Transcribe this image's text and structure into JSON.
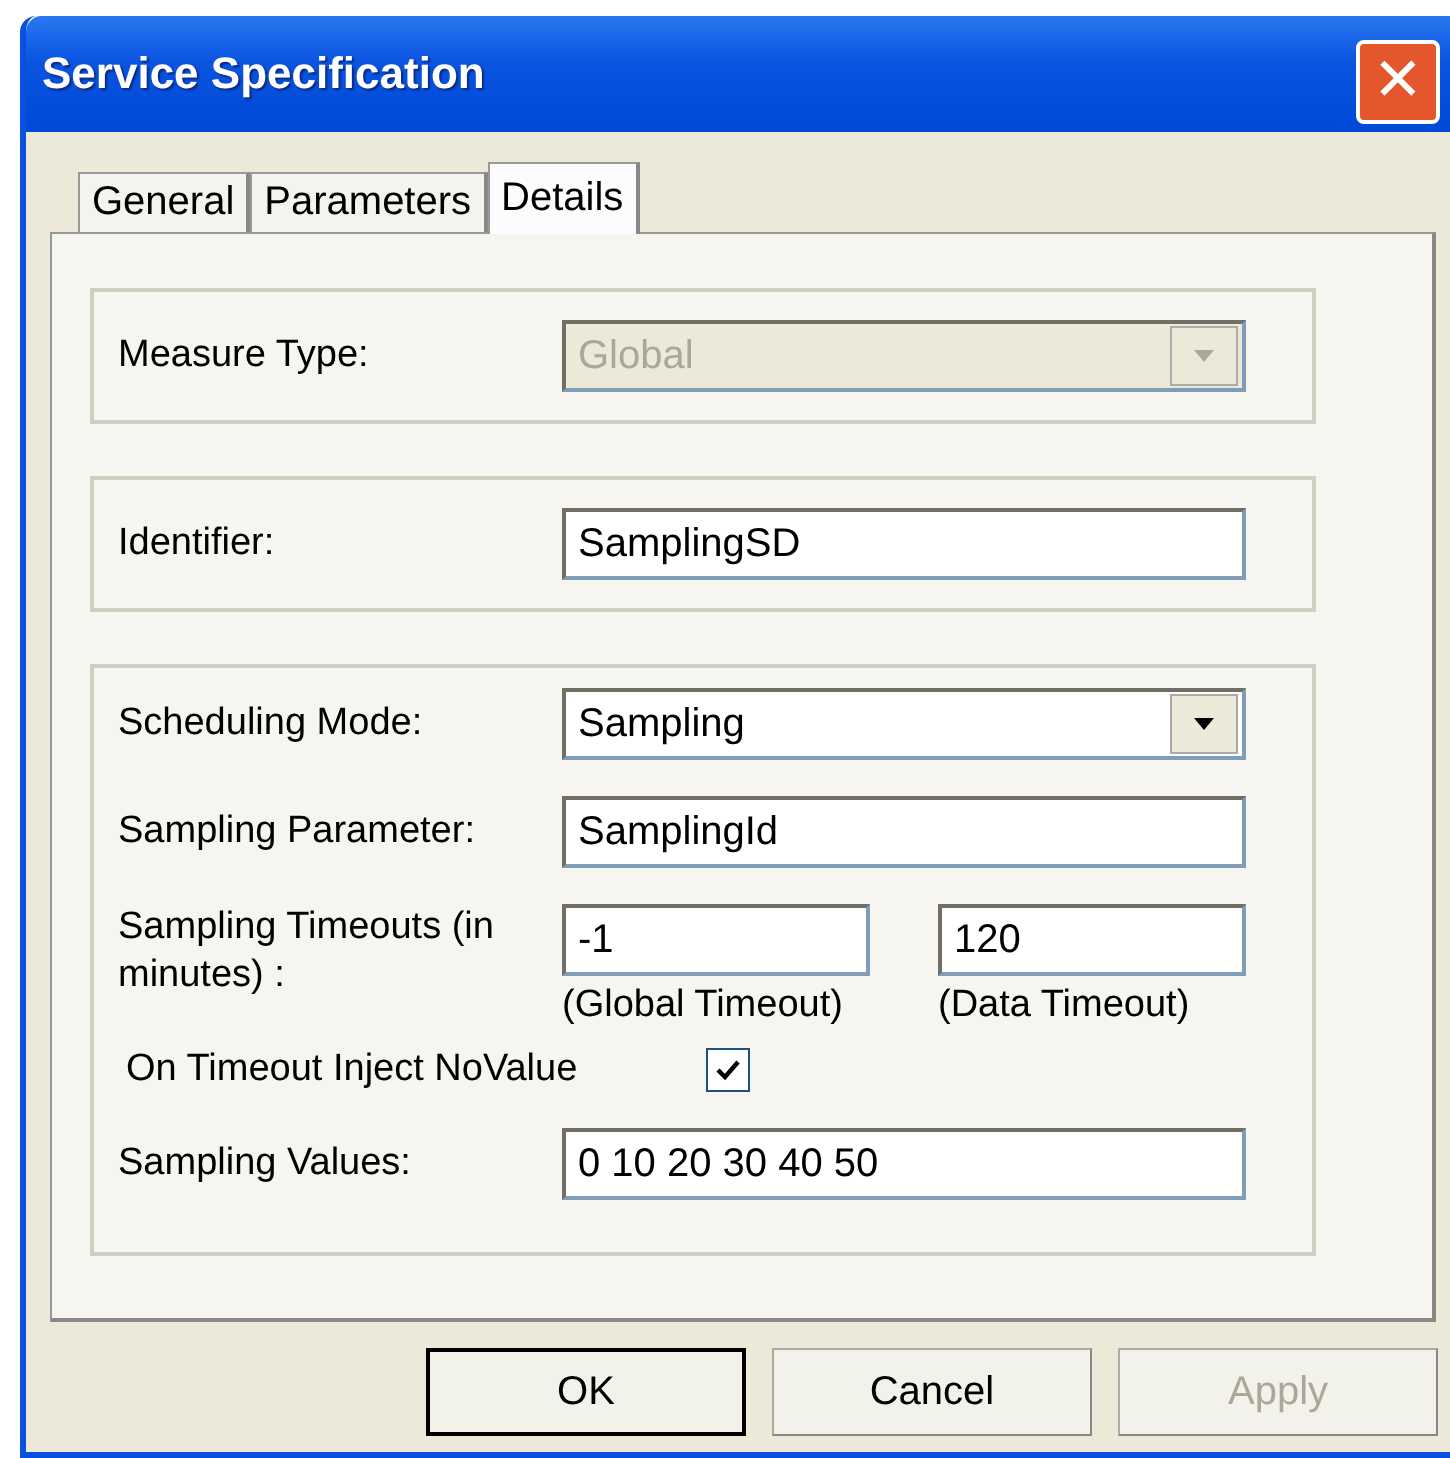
{
  "window": {
    "title": "Service Specification",
    "close": "✕"
  },
  "tabs": [
    {
      "label": "General",
      "selected": false
    },
    {
      "label": "Parameters",
      "selected": false
    },
    {
      "label": "Details",
      "selected": true
    }
  ],
  "groups": [
    {
      "rows": [
        {
          "kind": "combo",
          "label": "Measure Type:",
          "value": "Global",
          "disabled": true
        }
      ]
    },
    {
      "rows": [
        {
          "kind": "text",
          "label": "Identifier:",
          "value": "SamplingSD"
        }
      ]
    },
    {
      "rows": [
        {
          "kind": "combo",
          "label": "Scheduling Mode:",
          "value": "Sampling",
          "disabled": false
        },
        {
          "kind": "text",
          "label": "Sampling Parameter:",
          "value": "SamplingId"
        },
        {
          "kind": "pair",
          "label": "Sampling Timeouts (in minutes) :",
          "fields": [
            {
              "value": "-1",
              "caption": "(Global Timeout)"
            },
            {
              "value": "120",
              "caption": "(Data Timeout)"
            }
          ]
        },
        {
          "kind": "check",
          "label": "On Timeout Inject NoValue",
          "checked": true
        },
        {
          "kind": "text",
          "label": "Sampling Values:",
          "value": "0 10 20 30 40 50"
        }
      ]
    }
  ],
  "buttons": [
    {
      "label": "OK",
      "default": true,
      "disabled": false
    },
    {
      "label": "Cancel",
      "default": false,
      "disabled": false
    },
    {
      "label": "Apply",
      "default": false,
      "disabled": true
    }
  ]
}
